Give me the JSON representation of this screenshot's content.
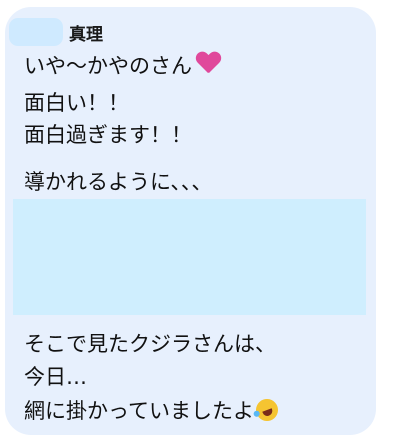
{
  "message": {
    "sender_name": "真理",
    "lines": [
      "いや〜かやのさん",
      "面白い！！",
      "面白過ぎます！！",
      "導かれるように、、、",
      "そこで見たクジラさんは、",
      "今日…",
      "網に掛かっていましたよ"
    ],
    "icons": {
      "line1_emoji": "pink-heart-icon",
      "line7_emoji": "rolling-laughing-face-icon"
    }
  },
  "colors": {
    "bubble_background": "#e7f0fd",
    "redaction": "#cfeefe",
    "text": "#111111"
  }
}
